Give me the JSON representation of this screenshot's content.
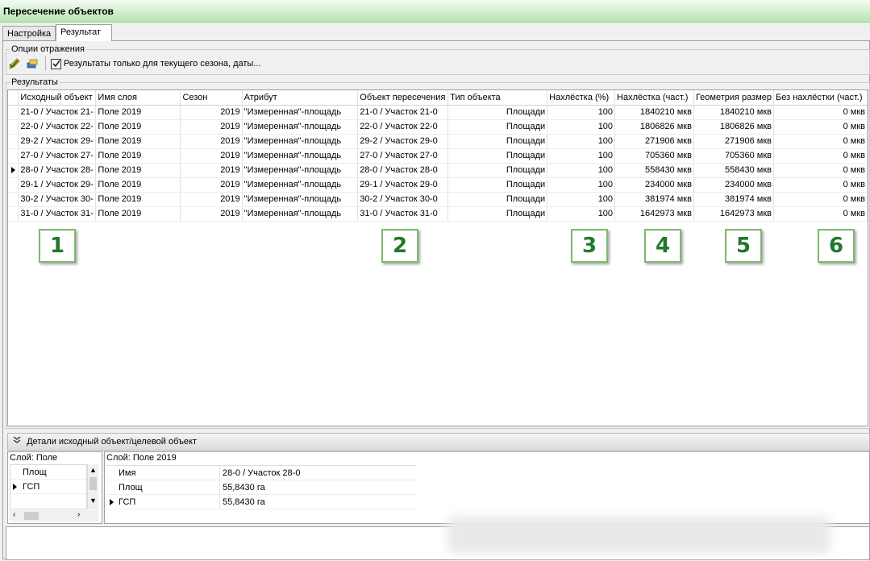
{
  "window": {
    "title": "Пересечение объектов"
  },
  "tabs": [
    {
      "label": "Настройка",
      "active": false
    },
    {
      "label": "Результат",
      "active": true
    }
  ],
  "options": {
    "legend": "Опции отражения",
    "tool1_icon": "pencil-check-icon",
    "tool2_icon": "layers-icon",
    "checkbox_label": "Результаты только для текущего сезона, даты...",
    "checkbox_checked": true
  },
  "results": {
    "legend": "Результаты",
    "columns": [
      "Исходный объект",
      "Имя слоя",
      "Сезон",
      "Атрибут",
      "Объект пересечения",
      "Тип объекта",
      "Нахлёстка (%)",
      "Нахлёстка (част.)",
      "Геометрия размер",
      "Без нахлёстки (част.)"
    ],
    "rows": [
      [
        "21-0 / Участок 21-",
        "Поле 2019",
        "2019",
        "\"Измеренная\"-площадь",
        "21-0 / Участок 21-0",
        "Площади",
        "100",
        "1840210 мкв",
        "1840210 мкв",
        "0 мкв"
      ],
      [
        "22-0 / Участок 22-",
        "Поле 2019",
        "2019",
        "\"Измеренная\"-площадь",
        "22-0 / Участок 22-0",
        "Площади",
        "100",
        "1806826 мкв",
        "1806826 мкв",
        "0 мкв"
      ],
      [
        "29-2 / Участок 29-",
        "Поле 2019",
        "2019",
        "\"Измеренная\"-площадь",
        "29-2 / Участок 29-0",
        "Площади",
        "100",
        "271906 мкв",
        "271906 мкв",
        "0 мкв"
      ],
      [
        "27-0 / Участок 27-",
        "Поле 2019",
        "2019",
        "\"Измеренная\"-площадь",
        "27-0 / Участок 27-0",
        "Площади",
        "100",
        "705360 мкв",
        "705360 мкв",
        "0 мкв"
      ],
      [
        "28-0 / Участок 28-",
        "Поле 2019",
        "2019",
        "\"Измеренная\"-площадь",
        "28-0 / Участок 28-0",
        "Площади",
        "100",
        "558430 мкв",
        "558430 мкв",
        "0 мкв"
      ],
      [
        "29-1 / Участок 29-",
        "Поле 2019",
        "2019",
        "\"Измеренная\"-площадь",
        "29-1 / Участок 29-0",
        "Площади",
        "100",
        "234000 мкв",
        "234000 мкв",
        "0 мкв"
      ],
      [
        "30-2 / Участок 30-",
        "Поле 2019",
        "2019",
        "\"Измеренная\"-площадь",
        "30-2 / Участок 30-0",
        "Площади",
        "100",
        "381974 мкв",
        "381974 мкв",
        "0 мкв"
      ],
      [
        "31-0 / Участок 31-",
        "Поле 2019",
        "2019",
        "\"Измеренная\"-площадь",
        "31-0 / Участок 31-0",
        "Площади",
        "100",
        "1642973 мкв",
        "1642973 мкв",
        "0 мкв"
      ]
    ],
    "selected_row": 4
  },
  "markers": [
    "1",
    "2",
    "3",
    "4",
    "5",
    "6"
  ],
  "details": {
    "header": "Детали исходный объект/целевой объект",
    "left_title": "Слой: Поле",
    "left_items": [
      "Площ",
      "ГСП"
    ],
    "left_selected": 1,
    "right_title": "Слой: Поле 2019",
    "props": [
      {
        "name": "Имя",
        "value": "28-0 / Участок 28-0"
      },
      {
        "name": "Площ",
        "value": "55,8430 га"
      },
      {
        "name": "ГСП",
        "value": "55,8430 га"
      }
    ],
    "props_selected": 2
  },
  "colors": {
    "marker_green": "#1f7a2a",
    "titlebar_green": "#cdeec9"
  }
}
